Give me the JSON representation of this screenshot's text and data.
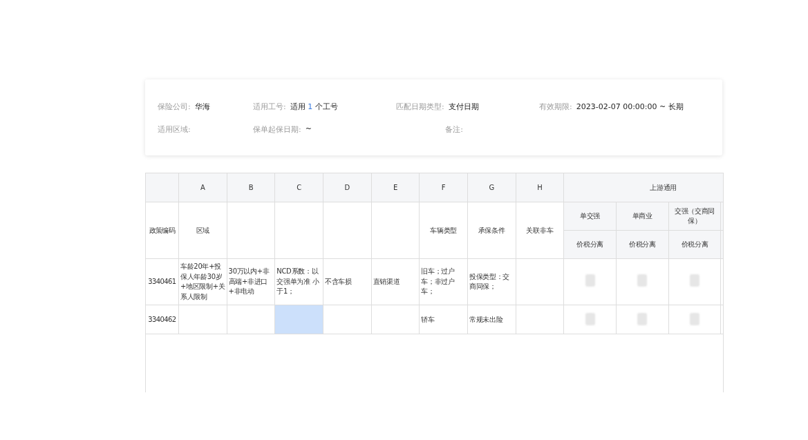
{
  "info": {
    "rows": [
      [
        {
          "label": "保险公司:",
          "kind": "text",
          "value": "华海"
        },
        {
          "label": "适用工号:",
          "kind": "count",
          "prefix": "适用",
          "count": "1",
          "suffix": "个工号"
        },
        {
          "label": "匹配日期类型:",
          "kind": "text",
          "value": "支付日期"
        },
        {
          "label": "有效期限:",
          "kind": "text",
          "value": "2023-02-07 00:00:00 ~ 长期"
        }
      ],
      [
        {
          "label": "适用区域:",
          "kind": "text"
        },
        {
          "label": "保单起保日期:",
          "kind": "text",
          "value": "~"
        },
        {
          "label": "备注:",
          "kind": "text"
        }
      ]
    ]
  },
  "table": {
    "code_header": "政策编码",
    "columns": [
      {
        "letter": "A",
        "header": "区域"
      },
      {
        "letter": "B"
      },
      {
        "letter": "C"
      },
      {
        "letter": "D"
      },
      {
        "letter": "E"
      },
      {
        "letter": "F",
        "header": "车辆类型"
      },
      {
        "letter": "G",
        "header": "承保条件"
      },
      {
        "letter": "H",
        "header": "关联非车"
      }
    ],
    "group": "上游通用",
    "sub_headers": [
      "单交强",
      "单商业",
      "交强（交商同保）"
    ],
    "sub_sub_headers": [
      "价税分离",
      "价税分离",
      "价税分离"
    ],
    "rows": [
      {
        "code": "3340461",
        "cells": [
          {
            "text": "车龄20年+投保人年龄30岁+地区限制+关系人限制",
            "selected": false
          },
          {
            "text": "30万以内+非高端+非进口+非电动",
            "selected": false
          },
          {
            "text": "NCD系数：以交强单为准 小于1；",
            "selected": false
          },
          {
            "text": "不含车损",
            "selected": false
          },
          {
            "text": "直销渠道",
            "selected": false
          },
          {
            "text": "旧车；过户车；非过户车；",
            "selected": false
          },
          {
            "text": "投保类型：交商同保；",
            "selected": false
          },
          {
            "selected": false
          }
        ],
        "blurred": [
          true,
          true,
          true
        ]
      },
      {
        "code": "3340462",
        "cells": [
          {
            "selected": false
          },
          {
            "selected": false
          },
          {
            "selected": true
          },
          {
            "selected": false
          },
          {
            "selected": false
          },
          {
            "text": "轿车",
            "selected": false
          },
          {
            "text": "常规未出险",
            "selected": false
          },
          {
            "selected": false
          }
        ],
        "blurred": [
          true,
          true,
          true
        ]
      }
    ]
  }
}
